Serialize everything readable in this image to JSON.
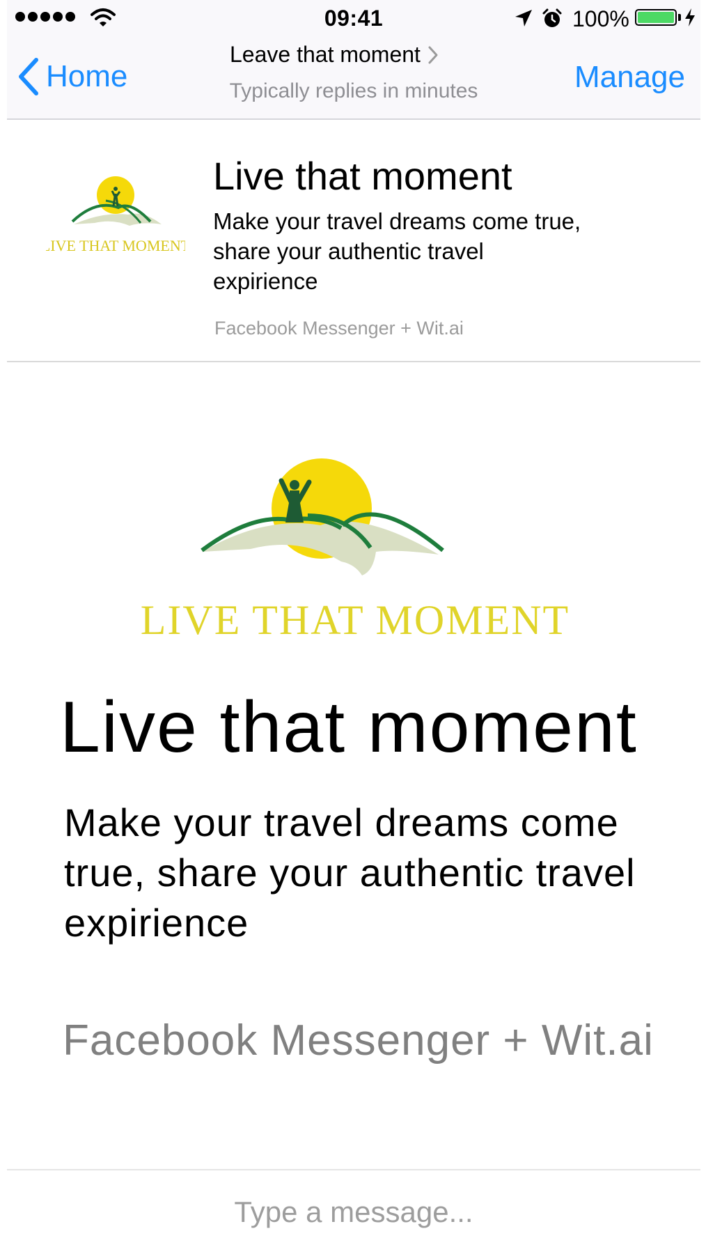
{
  "status_bar": {
    "time": "09:41",
    "battery_percent_label": "100%",
    "battery_level": 1.0,
    "icons": [
      "signal-dots-icon",
      "wifi-icon",
      "location-arrow-icon",
      "alarm-clock-icon",
      "battery-icon",
      "charging-bolt-icon"
    ]
  },
  "nav": {
    "back_label": "Home",
    "title": "Leave that moment",
    "subtitle": "Typically replies in minutes",
    "manage_label": "Manage"
  },
  "header_card": {
    "logo_text": "LIVE THAT MOMENT",
    "title": "Live that moment",
    "description": "Make your travel dreams come true, share your authentic travel expirience",
    "source": "Facebook Messenger + Wit.ai"
  },
  "main_card": {
    "logo_text": "LIVE THAT MOMENT",
    "title": "Live that moment",
    "description": "Make your travel dreams come true, share your authentic travel expirience",
    "source": "Facebook Messenger + Wit.ai"
  },
  "composer": {
    "placeholder": "Type a message..."
  },
  "colors": {
    "accent": "#1a8cff",
    "logo_yellow": "#f5d90a",
    "logo_green": "#1e7d3c",
    "logo_pale": "#d9dfc3",
    "battery_green": "#4cd964"
  }
}
